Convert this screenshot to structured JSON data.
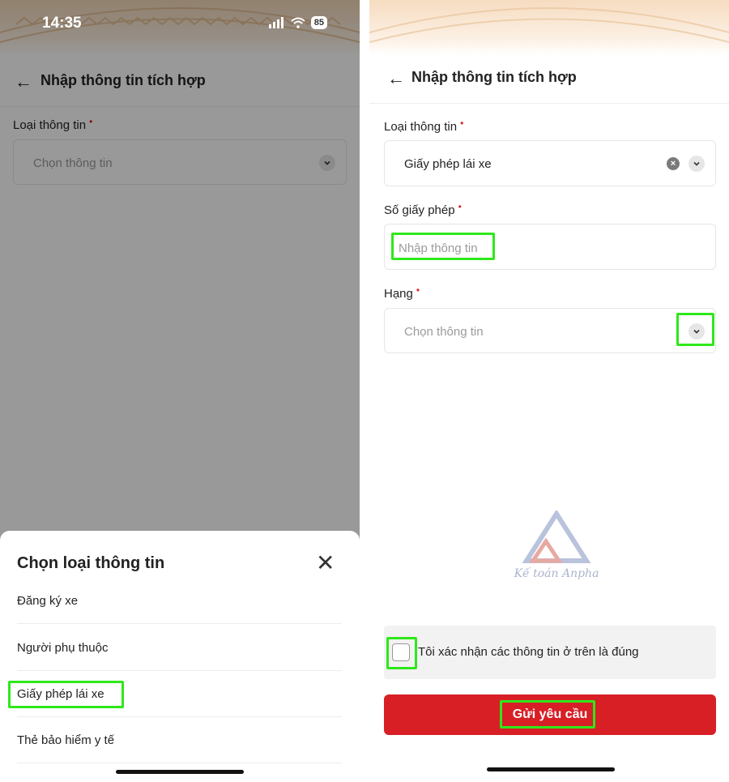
{
  "status_bar": {
    "time": "14:35",
    "battery": "85"
  },
  "header": {
    "title": "Nhập thông tin tích hợp"
  },
  "left": {
    "field_label": "Loại thông tin",
    "required_mark": "•",
    "select_placeholder": "Chọn thông tin",
    "sheet": {
      "title": "Chọn loại thông tin",
      "options": [
        "Đăng ký xe",
        "Người phụ thuộc",
        "Giấy phép lái xe",
        "Thẻ bảo hiểm y tế"
      ]
    }
  },
  "right": {
    "fields": [
      {
        "label": "Loại thông tin",
        "value": "Giấy phép lái xe"
      },
      {
        "label": "Số giấy phép",
        "placeholder": "Nhập thông tin"
      },
      {
        "label": "Hạng",
        "placeholder": "Chọn thông tin"
      }
    ],
    "required_mark": "•",
    "watermark": "Kế toán Anpha",
    "confirm_text": "Tôi xác nhận các thông tin ở trên là đúng",
    "submit_label": "Gửi yêu cầu"
  },
  "colors": {
    "accent_red": "#d81f26",
    "highlight": "#2ee81a",
    "required": "#e02020"
  },
  "icons": [
    "back-arrow-icon",
    "chevron-down-icon",
    "clear-icon",
    "close-icon",
    "signal-icon",
    "wifi-icon",
    "battery-icon"
  ]
}
